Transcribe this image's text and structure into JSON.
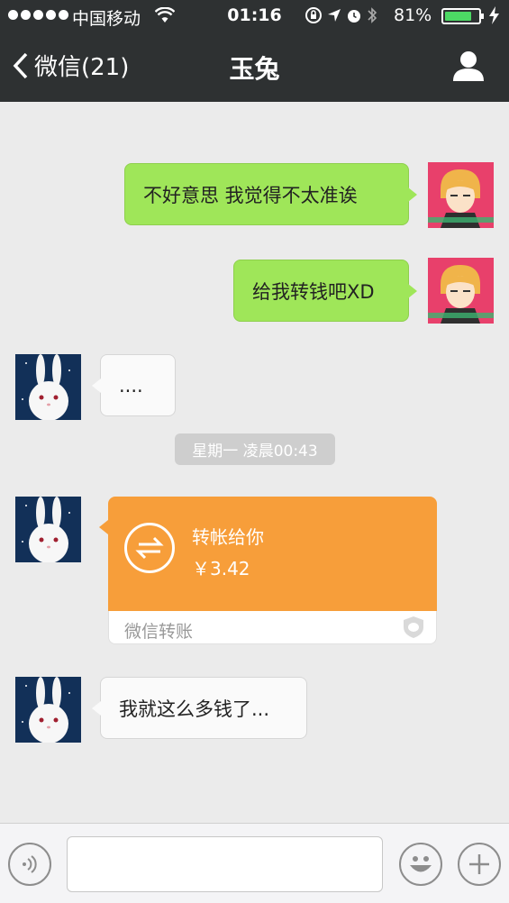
{
  "status_bar": {
    "carrier": "中国移动",
    "time": "01:16",
    "battery_pct_text": "81%",
    "battery_level": 0.81
  },
  "nav": {
    "back_label": "微信(21)",
    "title": "玉兔"
  },
  "messages": [
    {
      "from": "me",
      "text": "不好意思 我觉得不太准诶"
    },
    {
      "from": "me",
      "text": "给我转钱吧XD"
    },
    {
      "from": "friend",
      "text": "...."
    },
    {
      "from": "friend",
      "text": "我就这么多钱了..."
    }
  ],
  "timestamp": "星期一 凌晨00:43",
  "transfer": {
    "label": "转帐给你",
    "amount": "￥3.42",
    "brand": "微信转账"
  },
  "colors": {
    "header_bg": "#2e3132",
    "outgoing_bubble": "#9fe659",
    "transfer_orange": "#f79e3a",
    "battery_green": "#4cd964"
  },
  "icons": {
    "back": "chevron-left-icon",
    "profile": "person-icon",
    "voice": "voice-icon",
    "emoji": "smiley-icon",
    "more": "plus-icon",
    "transfer": "transfer-arrows-icon"
  }
}
